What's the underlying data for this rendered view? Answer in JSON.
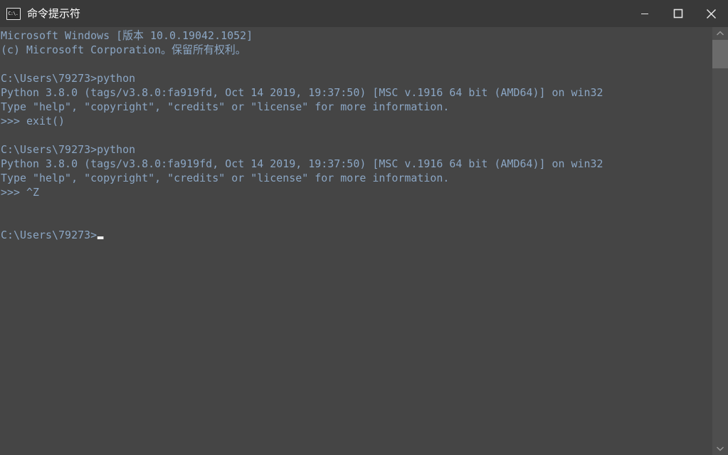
{
  "window": {
    "title": "命令提示符",
    "icon_label": "C:\\.",
    "icon_name": "command-prompt-icon",
    "background_color": "#454545",
    "titlebar_color": "#393939",
    "text_color": "#8ba6c4"
  },
  "controls": {
    "minimize_label": "最小化",
    "maximize_label": "最大化",
    "close_label": "关闭"
  },
  "scrollbar": {
    "up_label": "向上滚动",
    "down_label": "向下滚动",
    "thumb_label": "滚动条滑块"
  },
  "console": {
    "prompt": "C:\\Users\\79273>",
    "cursor": "_",
    "lines": [
      {
        "text": "Microsoft Windows [版本 10.0.19042.1052]"
      },
      {
        "text": "(c) Microsoft Corporation。保留所有权利。"
      },
      {
        "text": ""
      },
      {
        "text": "C:\\Users\\79273>python"
      },
      {
        "text": "Python 3.8.0 (tags/v3.8.0:fa919fd, Oct 14 2019, 19:37:50) [MSC v.1916 64 bit (AMD64)] on win32"
      },
      {
        "text": "Type \"help\", \"copyright\", \"credits\" or \"license\" for more information."
      },
      {
        "text": ">>> exit()"
      },
      {
        "text": ""
      },
      {
        "text": "C:\\Users\\79273>python"
      },
      {
        "text": "Python 3.8.0 (tags/v3.8.0:fa919fd, Oct 14 2019, 19:37:50) [MSC v.1916 64 bit (AMD64)] on win32"
      },
      {
        "text": "Type \"help\", \"copyright\", \"credits\" or \"license\" for more information."
      },
      {
        "text": ">>> ^Z"
      },
      {
        "text": ""
      },
      {
        "text": ""
      },
      {
        "text": "C:\\Users\\79273>",
        "cursor": true
      }
    ]
  }
}
